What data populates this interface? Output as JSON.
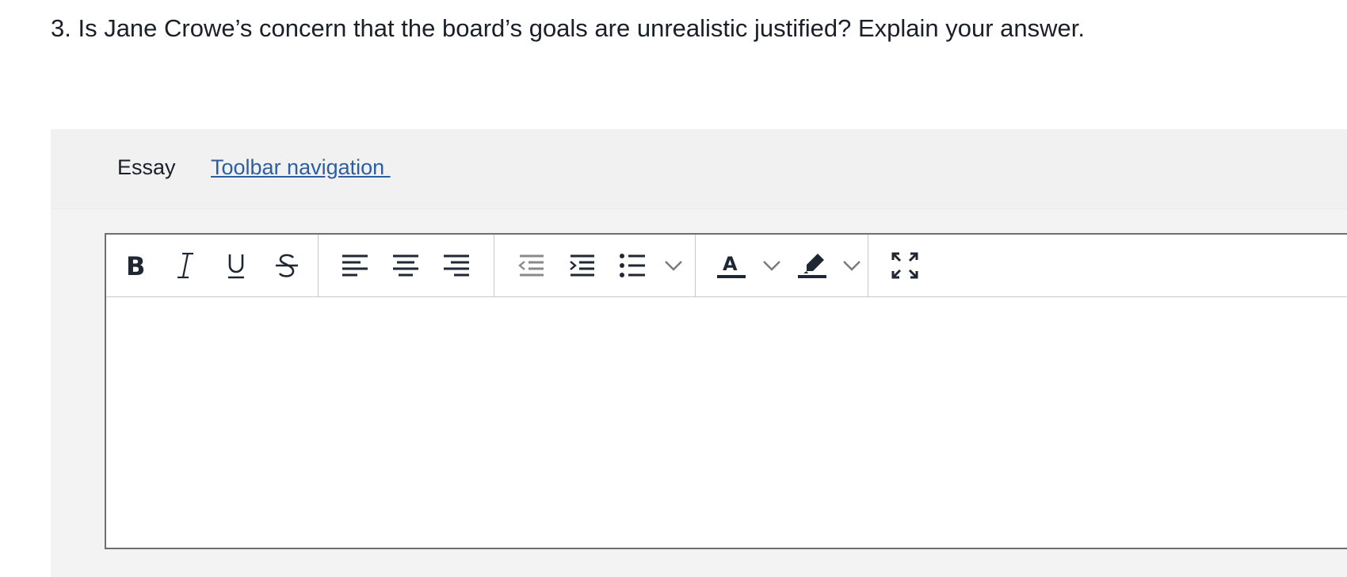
{
  "question": {
    "text": "3. Is Jane Crowe’s concern that the board’s goals are unrealistic justified? Explain your answer."
  },
  "panel": {
    "label": "Essay",
    "toolbar_link": "Toolbar navigation "
  },
  "toolbar": {
    "groups": [
      [
        "bold-icon",
        "italic-icon",
        "underline-icon",
        "strikethrough-icon"
      ],
      [
        "align-left-icon",
        "align-center-icon",
        "align-right-icon"
      ],
      [
        "outdent-icon",
        "indent-icon",
        "bullet-list-icon",
        "chevron-down-icon"
      ],
      [
        "text-color-icon",
        "chevron-down-icon",
        "highlight-icon",
        "chevron-down-icon"
      ],
      [
        "fullscreen-icon"
      ]
    ]
  },
  "colors": {
    "text": "#1a1f28",
    "link": "#2d5fa0",
    "icon": "#1f2733",
    "icon_disabled": "#8a8a8a",
    "panel_bg": "#f3f3f3"
  },
  "editor": {
    "content": ""
  }
}
